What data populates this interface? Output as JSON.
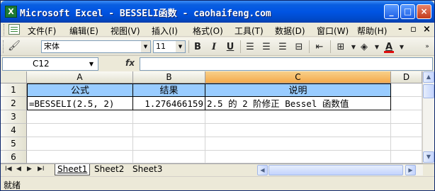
{
  "window": {
    "title": "Microsoft Excel - BESSELI函数 - caohaifeng.com",
    "app_icon": "X",
    "controls": {
      "minimize": "_",
      "maximize": "□",
      "close": "×"
    }
  },
  "menubar": {
    "items": [
      "文件(F)",
      "编辑(E)",
      "视图(V)",
      "插入(I)",
      "格式(O)",
      "工具(T)",
      "数据(D)",
      "窗口(W)",
      "帮助(H)"
    ],
    "doc_controls": [
      "-",
      "▫",
      "×"
    ]
  },
  "toolbar": {
    "font_name": "宋体",
    "font_size": "11",
    "bold": "B",
    "italic": "I",
    "underline": "U",
    "font_color_letter": "A",
    "accent_color": "#e01010"
  },
  "formula_bar": {
    "name_box": "C12",
    "fx_label": "fx",
    "formula": ""
  },
  "sheet": {
    "columns": [
      "A",
      "B",
      "C",
      "D"
    ],
    "active_column": "C",
    "rows": [
      "1",
      "2",
      "3",
      "4",
      "5",
      "6"
    ],
    "cells": {
      "A1": "公式",
      "B1": "结果",
      "C1": "说明",
      "A2": "=BESSELI(2.5, 2)",
      "B2": "1.276466159",
      "C2": "2.5 的 2 阶修正 Bessel 函数值"
    },
    "header_fill": "#99ccff"
  },
  "tabs": {
    "nav": [
      "I◀",
      "◀",
      "▶",
      "▶I"
    ],
    "sheets": [
      "Sheet1",
      "Sheet2",
      "Sheet3"
    ],
    "active_index": 0
  },
  "status": {
    "text": "就绪"
  }
}
